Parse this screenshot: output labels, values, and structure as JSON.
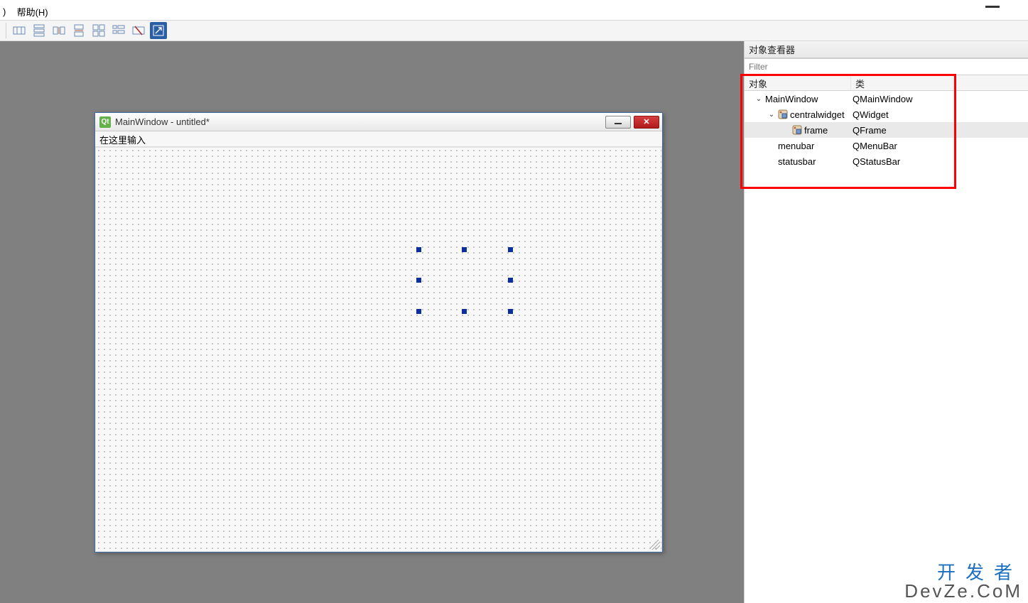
{
  "menu": {
    "partial": ")",
    "help": "帮助(H)"
  },
  "toolbar": {
    "buttons": [
      "layout-h",
      "layout-v",
      "layout-hsplit",
      "layout-vsplit",
      "layout-grid",
      "layout-form",
      "break-layout",
      "adjust-size"
    ]
  },
  "designWindow": {
    "title": "MainWindow - untitled*",
    "qtLogo": "Qt",
    "menubarHint": "在这里输入"
  },
  "inspector": {
    "title": "对象查看器",
    "filterPlaceholder": "Filter",
    "headers": {
      "object": "对象",
      "class": "类"
    },
    "rows": [
      {
        "name": "MainWindow",
        "class": "QMainWindow",
        "level": 0,
        "expanded": true,
        "icon": "none"
      },
      {
        "name": "centralwidget",
        "class": "QWidget",
        "level": 1,
        "expanded": true,
        "icon": "widget"
      },
      {
        "name": "frame",
        "class": "QFrame",
        "level": 2,
        "expanded": false,
        "icon": "widget",
        "selected": true
      },
      {
        "name": "menubar",
        "class": "QMenuBar",
        "level": 1,
        "expanded": false,
        "icon": "none"
      },
      {
        "name": "statusbar",
        "class": "QStatusBar",
        "level": 1,
        "expanded": false,
        "icon": "none"
      }
    ]
  },
  "watermark": {
    "zh": "开发者",
    "en": "DevZe.CoM"
  }
}
